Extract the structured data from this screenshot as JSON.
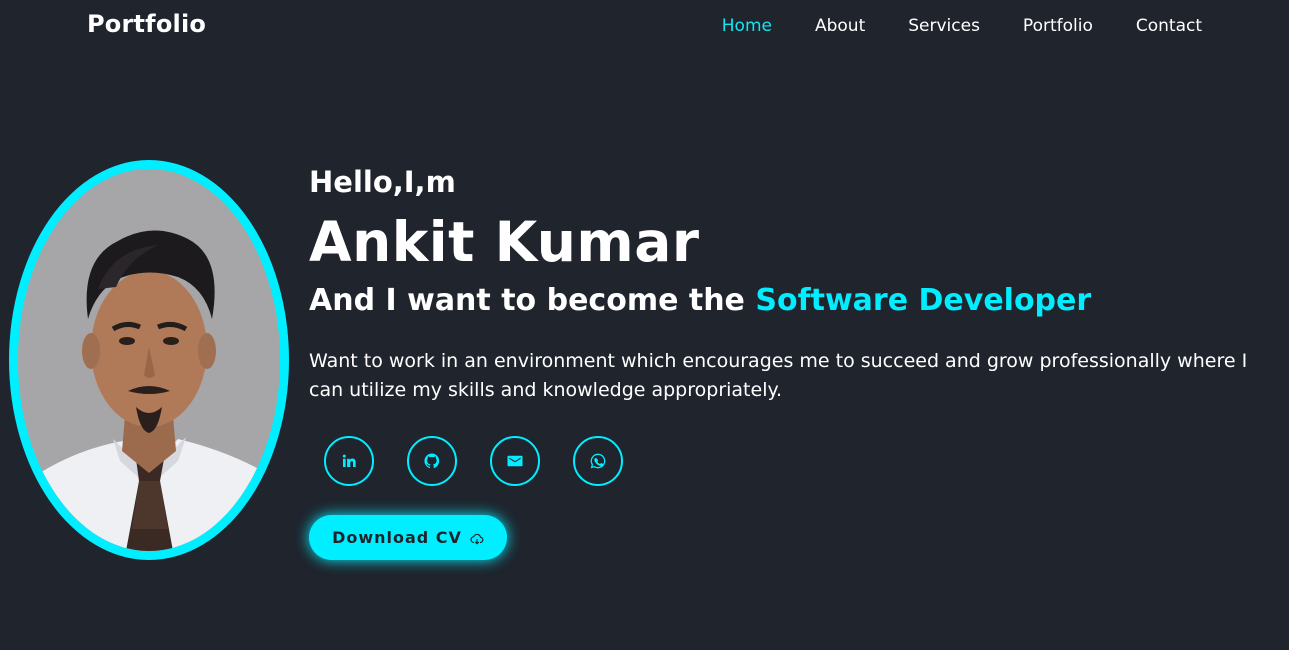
{
  "header": {
    "logo": "Portfolio",
    "nav": [
      {
        "label": "Home",
        "active": true
      },
      {
        "label": "About",
        "active": false
      },
      {
        "label": "Services",
        "active": false
      },
      {
        "label": "Portfolio",
        "active": false
      },
      {
        "label": "Contact",
        "active": false
      }
    ]
  },
  "hero": {
    "greeting": "Hello,I,m",
    "name": "Ankit Kumar",
    "role_prefix": "And I want to become the ",
    "role_highlight": "Software Developer",
    "description": "Want to work in an environment which encourages me to succeed and grow professionally where I can utilize my skills and knowledge appropriately.",
    "socials": [
      {
        "icon": "linkedin-icon"
      },
      {
        "icon": "github-icon"
      },
      {
        "icon": "mail-icon"
      },
      {
        "icon": "whatsapp-icon"
      }
    ],
    "cv_button": "Download CV",
    "cv_icon": "cloud-download-icon"
  },
  "colors": {
    "background": "#1f242d",
    "accent": "#00eeff",
    "text": "#ffffff"
  }
}
